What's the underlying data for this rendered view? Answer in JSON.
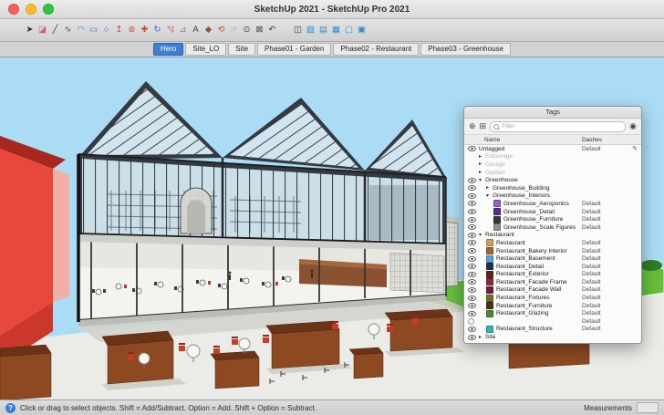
{
  "window": {
    "title": "SketchUp 2021 - SketchUp Pro 2021"
  },
  "toolbar": {
    "main_tools": [
      {
        "name": "select",
        "glyph": "➤",
        "color": "#2b2b2b"
      },
      {
        "name": "eraser",
        "glyph": "◪",
        "color": "#c95f7d"
      },
      {
        "name": "line",
        "glyph": "╱",
        "color": "#3d3d3d"
      },
      {
        "name": "freehand",
        "glyph": "∿",
        "color": "#3d3d3d"
      },
      {
        "name": "arc",
        "glyph": "◠",
        "color": "#2f6fce"
      },
      {
        "name": "rectangle",
        "glyph": "▭",
        "color": "#2f6fce"
      },
      {
        "name": "circle",
        "glyph": "○",
        "color": "#2f6fce"
      },
      {
        "name": "push-pull",
        "glyph": "↥",
        "color": "#cc4434"
      },
      {
        "name": "offset",
        "glyph": "⊚",
        "color": "#cc4434"
      },
      {
        "name": "move",
        "glyph": "✚",
        "color": "#cc4434"
      },
      {
        "name": "rotate",
        "glyph": "↻",
        "color": "#2f6fce"
      },
      {
        "name": "scale",
        "glyph": "◹",
        "color": "#cc4434"
      },
      {
        "name": "tape-measure",
        "glyph": "⊿",
        "color": "#b5679c"
      },
      {
        "name": "text",
        "glyph": "A",
        "color": "#3d3d3d"
      },
      {
        "name": "paint-bucket",
        "glyph": "◆",
        "color": "#8a5a2a"
      },
      {
        "name": "orbit",
        "glyph": "⟲",
        "color": "#cc4434"
      },
      {
        "name": "pan",
        "glyph": "☞",
        "color": "#b08a56"
      },
      {
        "name": "zoom",
        "glyph": "⊙",
        "color": "#3d3d3d"
      },
      {
        "name": "zoom-extents",
        "glyph": "⊠",
        "color": "#3d3d3d"
      },
      {
        "name": "previous-view",
        "glyph": "↶",
        "color": "#3d3d3d"
      }
    ],
    "view_tools": [
      {
        "name": "section-plane",
        "glyph": "◫",
        "color": "#3d3d3d"
      },
      {
        "name": "x-ray-style",
        "glyph": "▧",
        "color": "#2f8fce"
      },
      {
        "name": "back-edges-style",
        "glyph": "▤",
        "color": "#2f8fce"
      },
      {
        "name": "wireframe-style",
        "glyph": "▦",
        "color": "#2f8fce"
      },
      {
        "name": "hidden-line-style",
        "glyph": "▢",
        "color": "#2f8fce"
      },
      {
        "name": "shaded-style",
        "glyph": "▣",
        "color": "#2f8fce"
      }
    ]
  },
  "scene_tabs": [
    {
      "label": "Hero",
      "active": true
    },
    {
      "label": "Site_LO",
      "active": false
    },
    {
      "label": "Site",
      "active": false
    },
    {
      "label": "Phase01 - Garden",
      "active": false
    },
    {
      "label": "Phase02 - Restaurant",
      "active": false
    },
    {
      "label": "Phase03 - Greenhouse",
      "active": false
    }
  ],
  "tags_panel": {
    "title": "Tags",
    "filter_placeholder": "Filter",
    "name_column": "Name",
    "dashes_column": "Dashes",
    "icons": {
      "add_tag": "⊕",
      "add_tag_folder": "⊞",
      "details": "◉"
    },
    "rows": [
      {
        "name": "Untagged",
        "indent": 0,
        "type": "tag",
        "vis": "on",
        "swatch": null,
        "dashes": "Default",
        "pencil": true
      },
      {
        "name": "Entourage",
        "indent": 0,
        "type": "folder",
        "expander": "closed",
        "vis": "none",
        "swatch": null,
        "dashes": "",
        "dimmed": true
      },
      {
        "name": "Garage",
        "indent": 0,
        "type": "folder",
        "expander": "closed",
        "vis": "none",
        "swatch": null,
        "dashes": "",
        "dimmed": true
      },
      {
        "name": "Garden",
        "indent": 0,
        "type": "folder",
        "expander": "closed",
        "vis": "none",
        "swatch": null,
        "dashes": "",
        "dimmed": true
      },
      {
        "name": "Greenhouse",
        "indent": 0,
        "type": "folder",
        "expander": "open",
        "vis": "on",
        "swatch": null,
        "dashes": ""
      },
      {
        "name": "Greenhouse_Building",
        "indent": 1,
        "type": "folder",
        "expander": "closed",
        "vis": "on",
        "swatch": null,
        "dashes": ""
      },
      {
        "name": "Greenhouse_Interiors",
        "indent": 1,
        "type": "folder",
        "expander": "open",
        "vis": "on",
        "swatch": null,
        "dashes": ""
      },
      {
        "name": "Greenhouse_Aeroponics",
        "indent": 2,
        "type": "tag",
        "vis": "on",
        "swatch": "#9b59d0",
        "dashes": "Default"
      },
      {
        "name": "Greenhouse_Detail",
        "indent": 2,
        "type": "tag",
        "vis": "on",
        "swatch": "#5b2d86",
        "dashes": "Default"
      },
      {
        "name": "Greenhouse_Furniture",
        "indent": 2,
        "type": "tag",
        "vis": "on",
        "swatch": "#3a3440",
        "dashes": "Default"
      },
      {
        "name": "Greenhouse_Scale Figures",
        "indent": 2,
        "type": "tag",
        "vis": "on",
        "swatch": "#8f8f8f",
        "dashes": "Default"
      },
      {
        "name": "Restaurant",
        "indent": 0,
        "type": "folder",
        "expander": "open",
        "vis": "on",
        "swatch": null,
        "dashes": ""
      },
      {
        "name": "Restaurant",
        "indent": 1,
        "type": "tag",
        "vis": "on",
        "swatch": "#c9a35e",
        "dashes": "Default"
      },
      {
        "name": "Restaurant_Bakery Interior",
        "indent": 1,
        "type": "tag",
        "vis": "on",
        "swatch": "#9c6a2e",
        "dashes": "Default"
      },
      {
        "name": "Restaurant_Basement",
        "indent": 1,
        "type": "tag",
        "vis": "on",
        "swatch": "#4fa8d8",
        "dashes": "Default"
      },
      {
        "name": "Restaurant_Detail",
        "indent": 1,
        "type": "tag",
        "vis": "on",
        "swatch": "#23304f",
        "dashes": "Default"
      },
      {
        "name": "Restaurant_Exterior",
        "indent": 1,
        "type": "tag",
        "vis": "on",
        "swatch": "#5e2420",
        "dashes": "Default"
      },
      {
        "name": "Restaurant_Facade Frame",
        "indent": 1,
        "type": "tag",
        "vis": "on",
        "swatch": "#8e2737",
        "dashes": "Default"
      },
      {
        "name": "Restaurant_Facade Wall",
        "indent": 1,
        "type": "tag",
        "vis": "on",
        "swatch": "#6e1f40",
        "dashes": "Default"
      },
      {
        "name": "Restaurant_Fixtures",
        "indent": 1,
        "type": "tag",
        "vis": "on",
        "swatch": "#6e6e23",
        "dashes": "Default"
      },
      {
        "name": "Restaurant_Furniture",
        "indent": 1,
        "type": "tag",
        "vis": "on",
        "swatch": "#4a2e1a",
        "dashes": "Default"
      },
      {
        "name": "Restaurant_Glazing",
        "indent": 1,
        "type": "tag",
        "vis": "on",
        "swatch": "#3f8c35",
        "dashes": "Default"
      },
      {
        "name": "",
        "indent": 1,
        "type": "tag",
        "vis": "off",
        "swatch": null,
        "dashes": "Default"
      },
      {
        "name": "Restaurant_Structure",
        "indent": 1,
        "type": "tag",
        "vis": "on",
        "swatch": "#35b5ad",
        "dashes": "Default"
      },
      {
        "name": "Site",
        "indent": 0,
        "type": "folder",
        "expander": "closed",
        "vis": "on",
        "swatch": null,
        "dashes": ""
      }
    ]
  },
  "status_bar": {
    "help_glyph": "?",
    "hint": "Click or drag to select objects. Shift = Add/Subtract. Option = Add. Shift + Option = Subtract.",
    "measurements_label": "Measurements"
  }
}
